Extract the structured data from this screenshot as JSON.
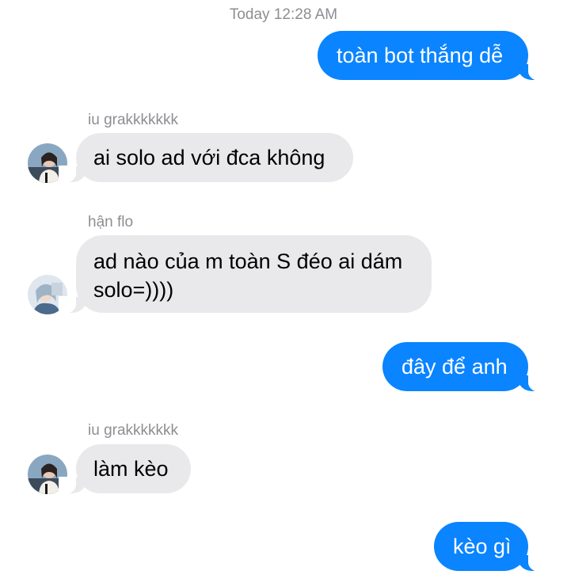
{
  "conversation": {
    "timestamp": "Today 12:28 AM",
    "messages": [
      {
        "direction": "outgoing",
        "text": "toàn bot thắng dễ"
      },
      {
        "direction": "incoming",
        "sender": "iu grakkkkkkk",
        "text": "ai solo ad với đca không"
      },
      {
        "direction": "incoming",
        "sender": "hận flo",
        "text": "ad nào của m toàn S đéo ai dám solo=))))"
      },
      {
        "direction": "outgoing",
        "text": "đây để anh"
      },
      {
        "direction": "incoming",
        "sender": "iu grakkkkkkk",
        "text": "làm kèo"
      },
      {
        "direction": "outgoing",
        "text": "kèo gì"
      }
    ]
  },
  "colors": {
    "outgoing_bubble": "#0a84ff",
    "incoming_bubble": "#e9e9eb",
    "meta_text": "#8e8e93"
  },
  "icons": {
    "avatar_1": "profile-photo",
    "avatar_2": "profile-photo"
  }
}
